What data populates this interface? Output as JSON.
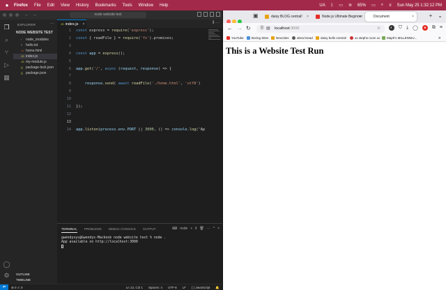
{
  "menubar": {
    "app": "Firefox",
    "items": [
      "File",
      "Edit",
      "View",
      "History",
      "Bookmarks",
      "Tools",
      "Window",
      "Help"
    ],
    "status": {
      "input": "UA",
      "battery": "65%",
      "datetime": "Sun May 25  1:32:12 PM"
    }
  },
  "vscode": {
    "search": "node website test",
    "explorer": {
      "header": "EXPLORER",
      "project": "NODE WEBSITE TEST",
      "items": [
        "node_modules",
        "hello.txt",
        "home.html",
        "index.js",
        "my-module.js",
        "package-lock.json",
        "package.json"
      ],
      "outline": "OUTLINE",
      "timeline": "TIMELINE"
    },
    "tab": "index.js",
    "code_lines": [
      {
        "n": "1",
        "text": "const express = require('express');"
      },
      {
        "n": "2",
        "text": "const { readFile } = require('fs').promises;"
      },
      {
        "n": "3",
        "text": ""
      },
      {
        "n": "4",
        "text": "const app = express();"
      },
      {
        "n": "5",
        "text": ""
      },
      {
        "n": "6",
        "text": "app.get('/', async (request, response) => {"
      },
      {
        "n": "7",
        "text": ""
      },
      {
        "n": "8",
        "text": "    response.send( await readFile('./home.html', 'utf8')"
      },
      {
        "n": "9",
        "text": ""
      },
      {
        "n": "10",
        "text": ""
      },
      {
        "n": "11",
        "text": "});"
      },
      {
        "n": "12",
        "text": ""
      },
      {
        "n": "13",
        "text": ""
      },
      {
        "n": "14",
        "text": "app.listen(process.env.PORT || 3000, () => console.log('Ap"
      }
    ],
    "panel": {
      "tabs": [
        "TERMINAL",
        "PROBLEMS",
        "DEBUG CONSOLE",
        "OUTPUT"
      ],
      "shell": "node",
      "terminal_lines": [
        "gwendysys@Gwendys-Macbook node website test % node .",
        "App available on http://localhost:3000"
      ]
    },
    "statusbar": {
      "left": "⊗ 0 ⚠ 0",
      "position": "Ln 13, Col 1",
      "spaces": "Spaces: 4",
      "encoding": "UTF-8",
      "eol": "LF",
      "language": "{ } JavaScript"
    }
  },
  "firefox": {
    "tabs": [
      {
        "label": "daisy BLOG central!",
        "color": "#e8a317"
      },
      {
        "label": "Node.js Ultimate Beginner",
        "color": "#e52d27"
      },
      {
        "label": "Document",
        "color": "#888888"
      }
    ],
    "url_host": "localhost",
    "url_port": ":3000",
    "bookmarks": [
      {
        "label": "YouTube",
        "color": "#e52d27"
      },
      {
        "label": "Boring Sites",
        "color": "#4a90d9"
      },
      {
        "label": "Neocities",
        "color": "#e8a317"
      },
      {
        "label": "alera bread",
        "color": "#5b5b5b"
      },
      {
        "label": "daisy bells central!",
        "color": "#e8a317"
      },
      {
        "label": "xx stephs room xx",
        "color": "#c33"
      },
      {
        "label": "Maph's MILLENNIU...",
        "color": "#7a5"
      }
    ],
    "page_heading": "This is a Website Test Run"
  },
  "colors": {
    "menubar": "#a3294a",
    "vscode_accent": "#0078d4"
  }
}
